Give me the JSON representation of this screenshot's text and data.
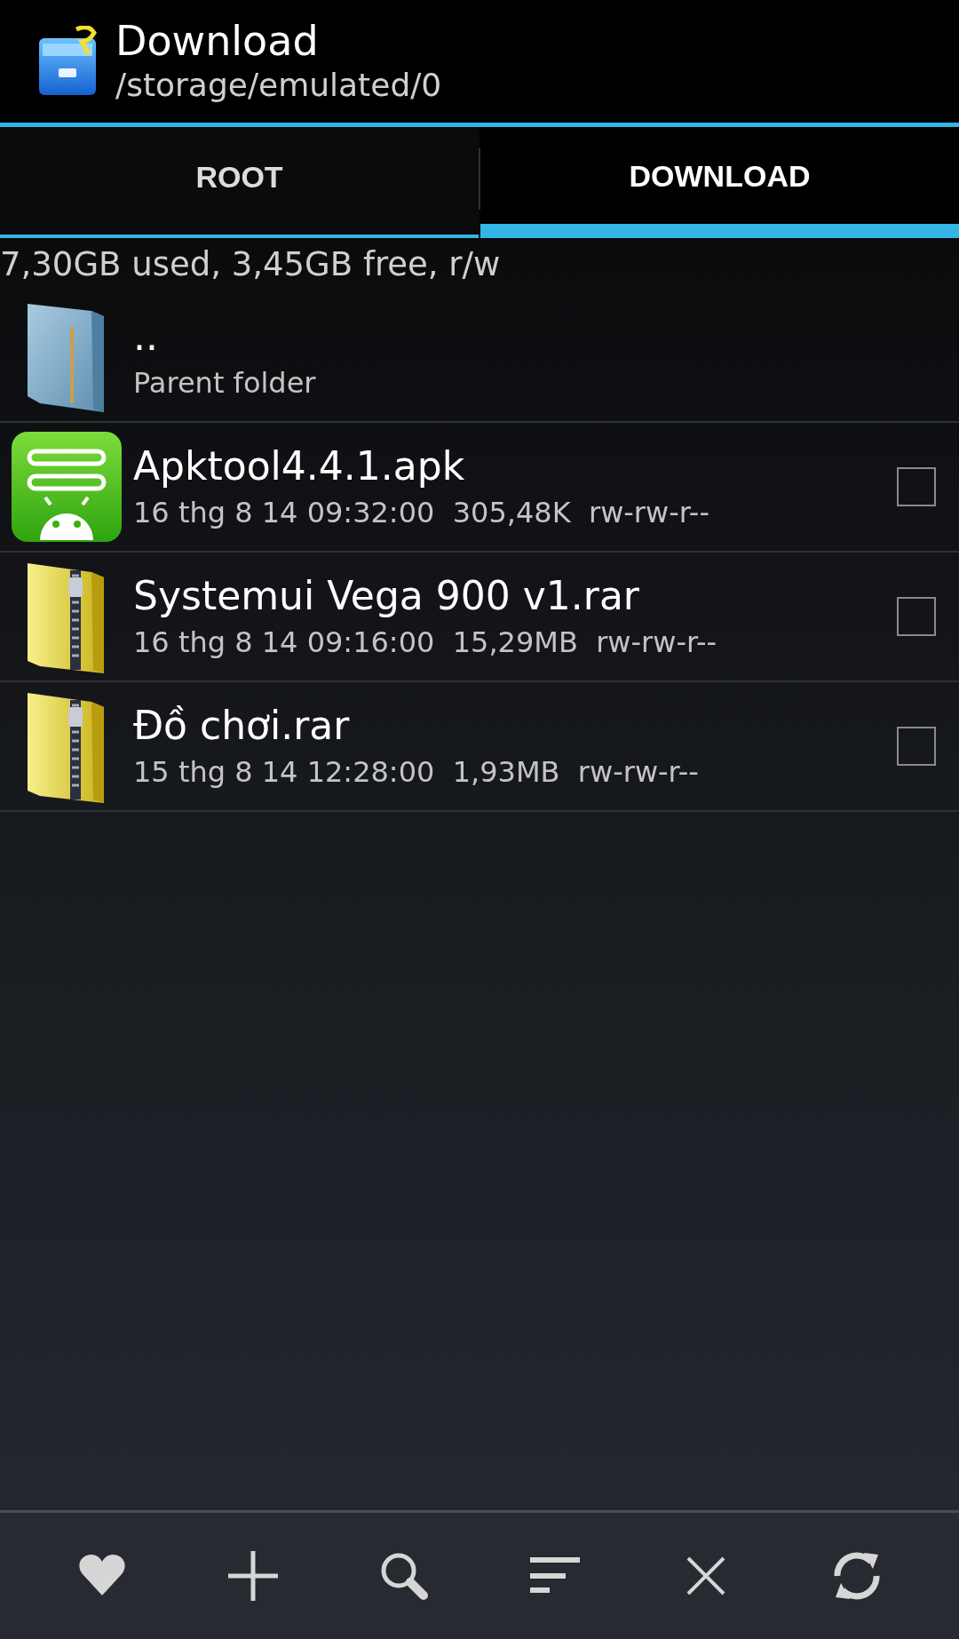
{
  "header": {
    "title": "Download",
    "path": "/storage/emulated/0"
  },
  "tabs": [
    {
      "label": "ROOT",
      "selected": false
    },
    {
      "label": "DOWNLOAD",
      "selected": true
    }
  ],
  "storage": "7,30GB used, 3,45GB free, r/w",
  "parent": {
    "name": "..",
    "label": "Parent folder"
  },
  "files": [
    {
      "kind": "apk",
      "name": "Apktool4.4.1.apk",
      "date": "16 thg 8 14 09:32:00",
      "size": "305,48K",
      "perms": "rw-rw-r--",
      "checked": false
    },
    {
      "kind": "archive",
      "name": "Systemui Vega 900 v1.rar",
      "date": "16 thg 8 14 09:16:00",
      "size": "15,29MB",
      "perms": "rw-rw-r--",
      "checked": false
    },
    {
      "kind": "archive",
      "name": "Đồ chơi.rar",
      "date": "15 thg 8 14 12:28:00",
      "size": "1,93MB",
      "perms": "rw-rw-r--",
      "checked": false
    }
  ],
  "toolbar": [
    {
      "kind": "favorite"
    },
    {
      "kind": "add"
    },
    {
      "kind": "search"
    },
    {
      "kind": "sort"
    },
    {
      "kind": "close"
    },
    {
      "kind": "refresh"
    }
  ]
}
